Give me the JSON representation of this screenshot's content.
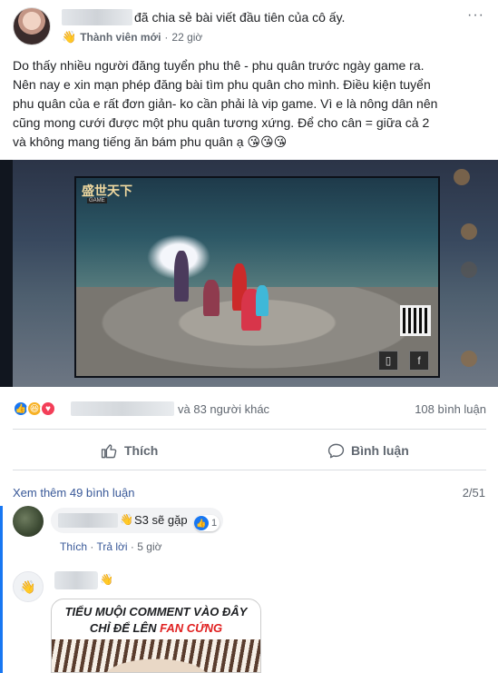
{
  "post": {
    "shared_text": "đã chia sẻ bài viết đầu tiên của cô ấy.",
    "more_icon": "···",
    "member_badge": "Thành viên mới",
    "separator": "·",
    "time": "22 giờ",
    "body_lines": [
      "Do thấy nhiều người đăng tuyển phu thê - phu quân trước ngày game ra.",
      "Nên nay e xin mạn phép đăng bài tìm phu quân cho mình. Điều kiện tuyển",
      "phu quân của e rất đơn giản- ko cần phải là vip game. Vì e là nông dân nên",
      "cũng mong cưới được một phu quân tương xứng. Để cho cân = giữa cả 2",
      "và không mang tiếng ăn bám phu quân ạ"
    ],
    "emojis": "😘😘😘"
  },
  "image": {
    "game_logo": "盛世天下",
    "game_logo_sub": "GAME"
  },
  "reactions": {
    "icons": [
      "like-icon",
      "haha-icon",
      "love-icon"
    ],
    "others_text": "và 83 người khác",
    "comments_count": "108 bình luận"
  },
  "actions": {
    "like_label": "Thích",
    "comment_label": "Bình luận"
  },
  "comments": {
    "view_more": "Xem thêm 49 bình luận",
    "page_count": "2/51",
    "first": {
      "text": "S3 sẽ gặp",
      "like_count": "1",
      "like_label": "Thích",
      "reply_label": "Trả lời",
      "time": "5 giờ"
    },
    "meme": {
      "line1": "TIỂU MUỘI COMMENT VÀO ĐÂY",
      "line2_prefix": "CHỈ ĐỂ LÊN ",
      "line2_red": "FAN CỨNG"
    }
  },
  "colors": {
    "accent_blue": "#1877f2",
    "link_blue": "#385898",
    "text_gray": "#606770"
  }
}
